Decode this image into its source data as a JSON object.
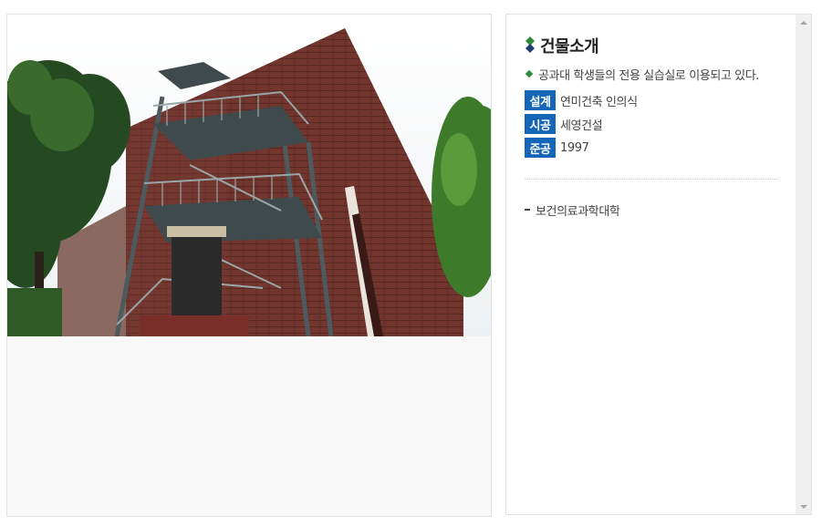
{
  "building": {
    "title": "건물소개",
    "description": "공과대 학생들의 전용 실습실로 이용되고 있다.",
    "specs": [
      {
        "label": "설계",
        "value": "연미건축 인의식"
      },
      {
        "label": "시공",
        "value": "세영건설"
      },
      {
        "label": "준공",
        "value": "1997"
      }
    ],
    "department": "보건의료과학대학"
  },
  "colors": {
    "spec_label_bg": "#1565b8",
    "bullet_green": "#2e8b3a",
    "icon_navy": "#1f3a6e"
  },
  "icons": {
    "title_icon": "diamond-stack-icon",
    "bullet": "diamond-bullet-icon",
    "dash": "dash-bullet-icon"
  }
}
